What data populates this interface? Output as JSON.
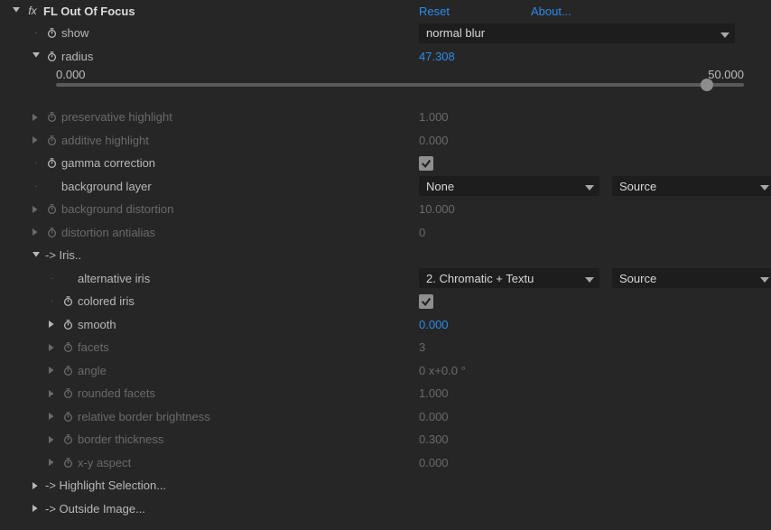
{
  "effect": {
    "name": "FL Out Of Focus",
    "reset": "Reset",
    "about": "About..."
  },
  "props": {
    "show": {
      "label": "show",
      "value": "normal blur"
    },
    "radius": {
      "label": "radius",
      "value": "47.308",
      "min": "0.000",
      "max": "50.000",
      "pct": 94.6
    },
    "preservative_highlight": {
      "label": "preservative highlight",
      "value": "1.000"
    },
    "additive_highlight": {
      "label": "additive highlight",
      "value": "0.000"
    },
    "gamma_correction": {
      "label": "gamma correction"
    },
    "background_layer": {
      "label": "background layer",
      "value": "None",
      "source": "Source"
    },
    "background_distortion": {
      "label": "background distortion",
      "value": "10.000"
    },
    "distortion_antialias": {
      "label": "distortion antialias",
      "value": "0"
    },
    "iris_group": {
      "label": "-> Iris.."
    },
    "alternative_iris": {
      "label": "alternative iris",
      "value": "2. Chromatic + Textu",
      "source": "Source"
    },
    "colored_iris": {
      "label": "colored iris"
    },
    "smooth": {
      "label": "smooth",
      "value": "0.000"
    },
    "facets": {
      "label": "facets",
      "value": "3"
    },
    "angle": {
      "label": "angle",
      "value": "0 x+0.0 °"
    },
    "rounded_facets": {
      "label": "rounded facets",
      "value": "1.000"
    },
    "relative_border_brightness": {
      "label": "relative border brightness",
      "value": "0.000"
    },
    "border_thickness": {
      "label": "border thickness",
      "value": "0.300"
    },
    "xy_aspect": {
      "label": "x-y aspect",
      "value": "0.000"
    },
    "highlight_selection": {
      "label": "-> Highlight Selection..."
    },
    "outside_image": {
      "label": "-> Outside Image..."
    }
  }
}
